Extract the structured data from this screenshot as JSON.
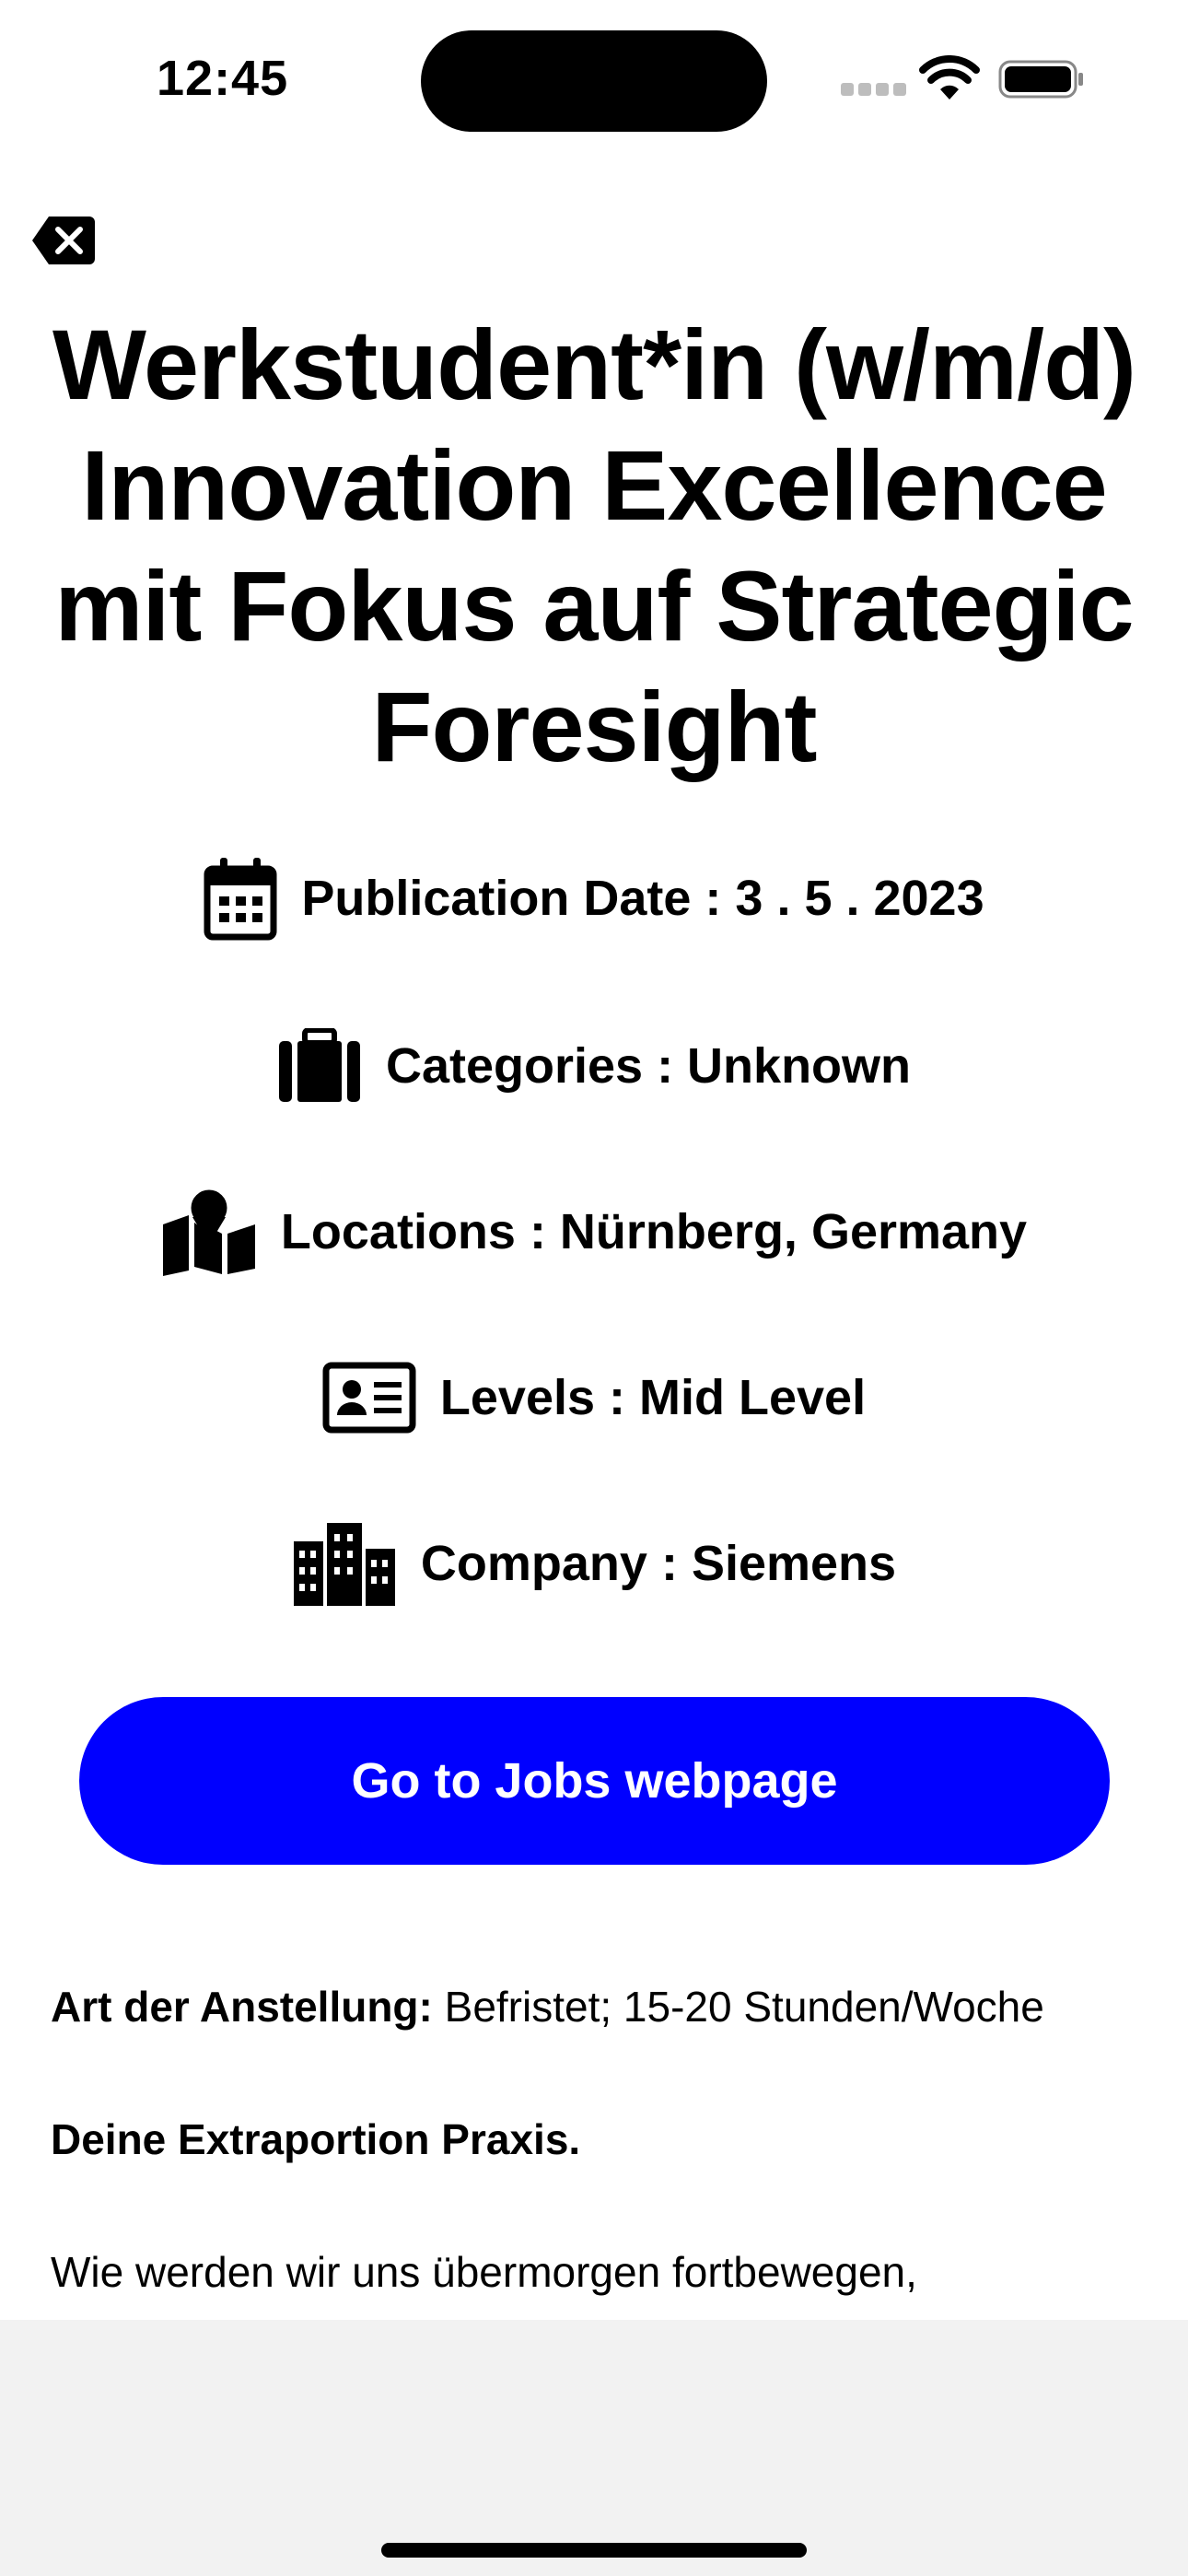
{
  "status": {
    "time": "12:45"
  },
  "job": {
    "title": "Werkstudent*in (w/m/d) Innovation Excellence mit Fokus auf Strategic Foresight"
  },
  "meta": {
    "publication": "Publication Date : 3 . 5 . 2023",
    "categories": "Categories : Unknown",
    "locations": "Locations : Nürnberg, Germany",
    "levels": "Levels : Mid Level",
    "company": "Company : Siemens"
  },
  "cta": {
    "label": "Go to Jobs webpage"
  },
  "description": {
    "employment_label": "Art der Anstellung:",
    "employment_value": " Befristet; 15-20 Stunden/Woche",
    "heading": "Deine Extraportion Praxis.",
    "intro": "Wie werden wir uns übermorgen fortbewegen,"
  },
  "colors": {
    "accent": "#0000ff",
    "text": "#000000",
    "bottom_area": "#f2f2f2"
  },
  "icons": [
    "close-icon",
    "calendar-icon",
    "briefcase-icon",
    "map-pin-icon",
    "id-card-icon",
    "building-icon",
    "wifi-icon",
    "battery-icon",
    "signal-icon"
  ]
}
